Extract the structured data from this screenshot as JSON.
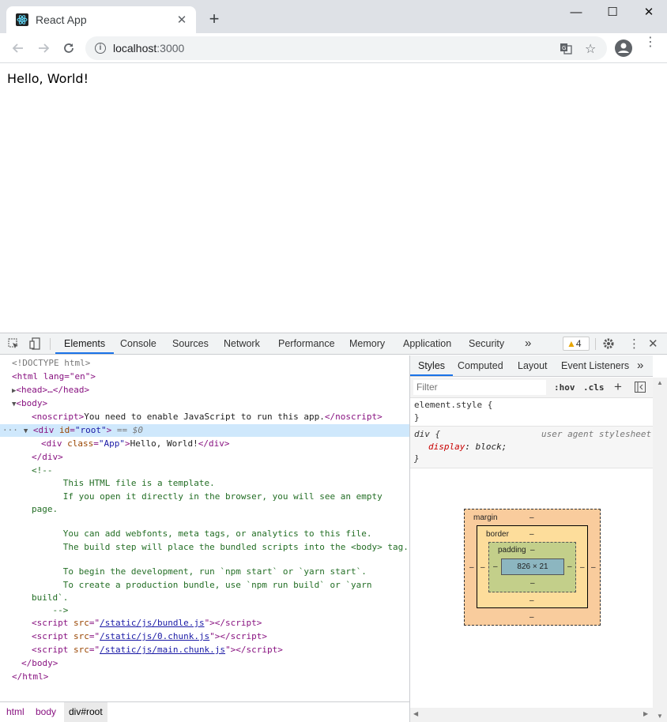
{
  "browser": {
    "tab_title": "React App",
    "tab_close": "✕",
    "new_tab": "+",
    "url_host": "localhost",
    "url_port": ":3000",
    "window_controls": {
      "minimize": "—",
      "maximize": "☐",
      "close": "✕"
    }
  },
  "page": {
    "content": "Hello, World!"
  },
  "devtools": {
    "tabs": [
      "Elements",
      "Console",
      "Sources",
      "Network",
      "Performance",
      "Memory",
      "Application",
      "Security"
    ],
    "active_tab": "Elements",
    "more_tabs": "»",
    "warnings_count": "4",
    "dom": {
      "doctype": "<!DOCTYPE html>",
      "html_open": "<html lang=\"en\">",
      "head": "<head>…</head>",
      "body_open": "<body>",
      "noscript_text": "You need to enable JavaScript to run this app.",
      "div_root": "<div id=\"root\">",
      "selected_marker": "== $0",
      "app_div_text": "Hello, World!",
      "div_close": "</div>",
      "comment_open": "<!--",
      "comment_lines": [
        "      This HTML file is a template.",
        "      If you open it directly in the browser, you will see an empty",
        "page.",
        "",
        "      You can add webfonts, meta tags, or analytics to this file.",
        "      The build step will place the bundled scripts into the <body> tag.",
        "",
        "      To begin the development, run `npm start` or `yarn start`.",
        "      To create a production bundle, use `npm run build` or `yarn",
        "build`."
      ],
      "comment_close": "    -->",
      "scripts": [
        "/static/js/bundle.js",
        "/static/js/0.chunk.js",
        "/static/js/main.chunk.js"
      ],
      "body_close": "</body>",
      "html_close": "</html>"
    },
    "breadcrumb": [
      "html",
      "body",
      "div#root"
    ],
    "styles": {
      "tabs": [
        "Styles",
        "Computed",
        "Layout",
        "Event Listeners"
      ],
      "more": "»",
      "filter_placeholder": "Filter",
      "hov": ":hov",
      "cls": ".cls",
      "add": "+",
      "element_style": "element.style {",
      "close_brace": "}",
      "rule_selector": "div {",
      "rule_source": "user agent stylesheet",
      "rule_prop": "display",
      "rule_value": "block;",
      "box_model": {
        "margin_label": "margin",
        "border_label": "border",
        "padding_label": "padding",
        "dash": "–",
        "content_size": "826 × 21"
      }
    }
  }
}
